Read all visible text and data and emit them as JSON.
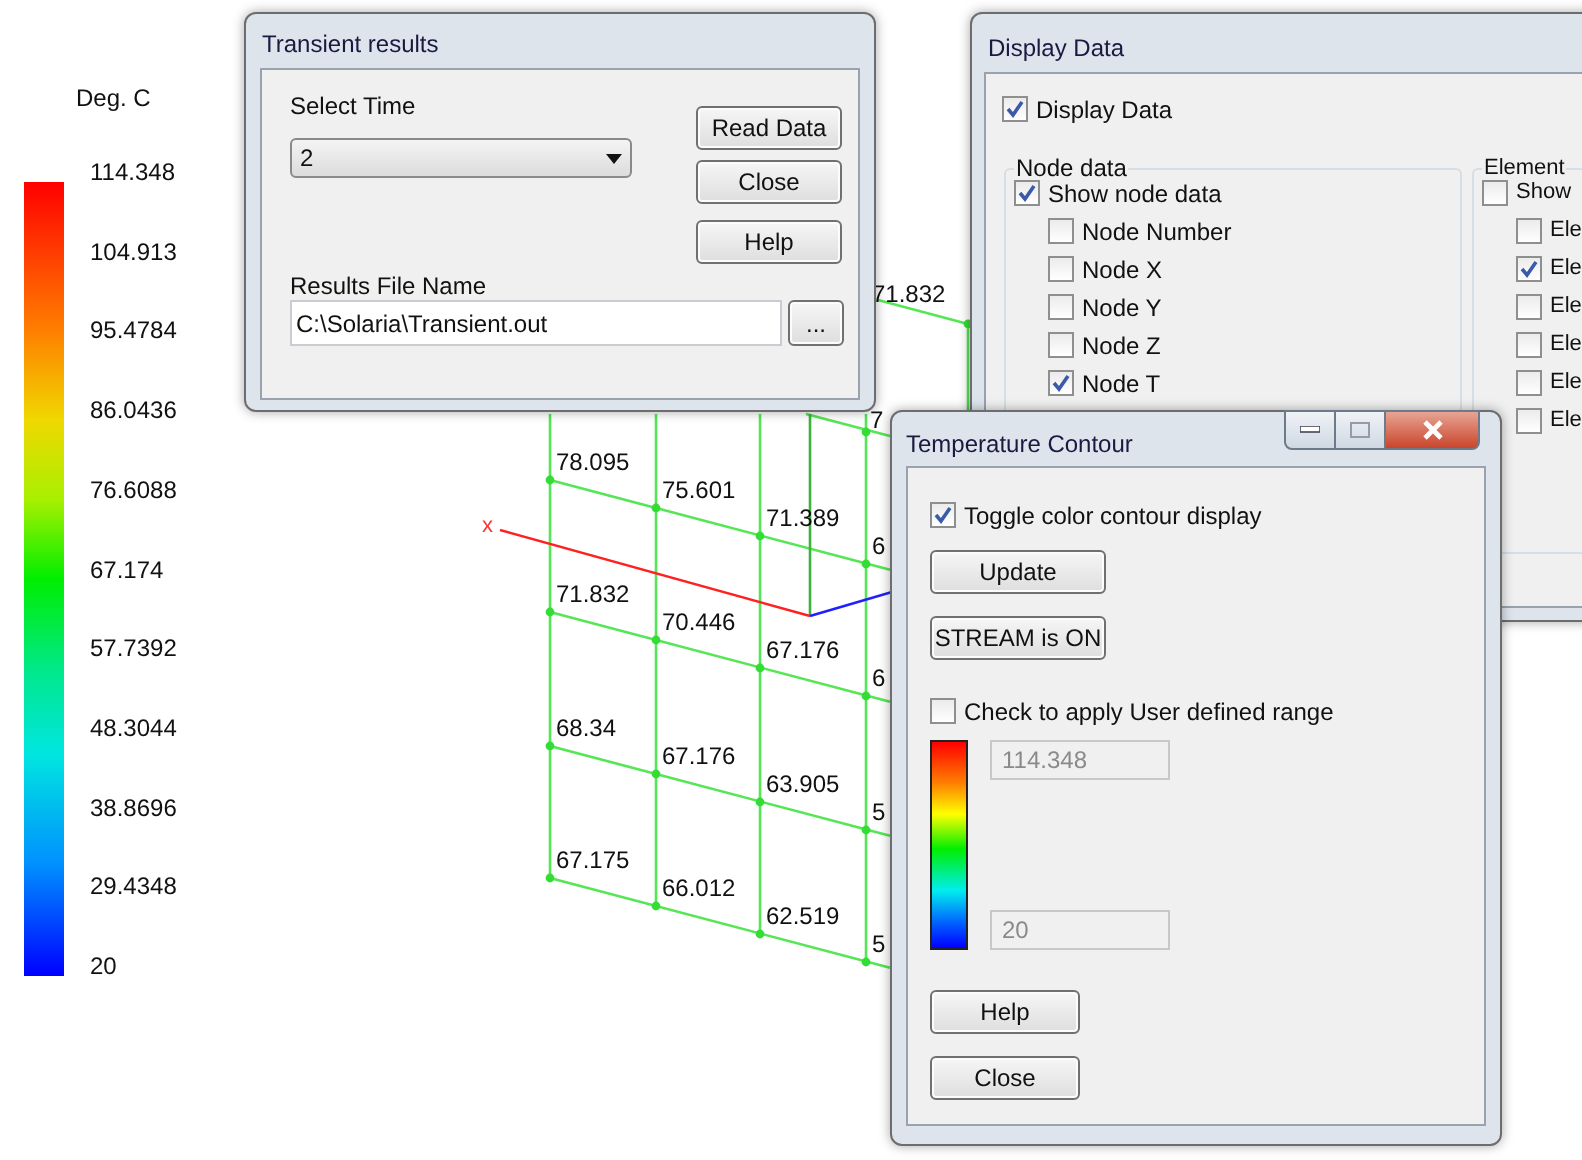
{
  "legend": {
    "title": "Deg. C",
    "labels": [
      "114.348",
      "104.913",
      "95.4784",
      "86.0436",
      "76.6088",
      "67.174",
      "57.7392",
      "48.3044",
      "38.8696",
      "29.4348",
      "20"
    ]
  },
  "mesh": {
    "axis_label": "x",
    "back_values": [
      "71.832",
      "7"
    ],
    "rows": [
      [
        "78.095",
        "75.601",
        "71.389",
        "6"
      ],
      [
        "71.832",
        "70.446",
        "67.176",
        "6"
      ],
      [
        "68.34",
        "67.176",
        "63.905",
        "5"
      ],
      [
        "67.175",
        "66.012",
        "62.519",
        "5"
      ]
    ]
  },
  "transient_results": {
    "title": "Transient results",
    "select_time_label": "Select Time",
    "time_value": "2",
    "buttons": [
      "Read Data",
      "Close",
      "Help"
    ],
    "file_label": "Results File Name",
    "file_value": "C:\\Solaria\\Transient.out",
    "browse_button": "..."
  },
  "display_data": {
    "title": "Display Data",
    "display_data": {
      "label": "Display Data",
      "checked": true
    },
    "node_data": {
      "title": "Node data",
      "show": {
        "label": "Show node data",
        "checked": true
      },
      "items": [
        {
          "label": "Node Number",
          "checked": false
        },
        {
          "label": "Node X",
          "checked": false
        },
        {
          "label": "Node Y",
          "checked": false
        },
        {
          "label": "Node Z",
          "checked": false
        },
        {
          "label": "Node T",
          "checked": true
        }
      ]
    },
    "element_data": {
      "title": "Element",
      "show": {
        "label": "Show",
        "checked": false
      },
      "items": [
        {
          "label": "Ele",
          "checked": false
        },
        {
          "label": "Ele",
          "checked": true
        },
        {
          "label": "Ele",
          "checked": false
        },
        {
          "label": "Ele",
          "checked": false
        },
        {
          "label": "Ele",
          "checked": false
        },
        {
          "label": "Ele",
          "checked": false
        }
      ]
    }
  },
  "temperature_contour": {
    "title": "Temperature Contour",
    "toggle": {
      "label": "Toggle color contour display",
      "checked": true
    },
    "update_button": "Update",
    "stream_button": "STREAM is ON",
    "user_range": {
      "label": "Check to apply User defined range",
      "checked": false
    },
    "max_value": "114.348",
    "min_value": "20",
    "help_button": "Help",
    "close_button": "Close"
  }
}
